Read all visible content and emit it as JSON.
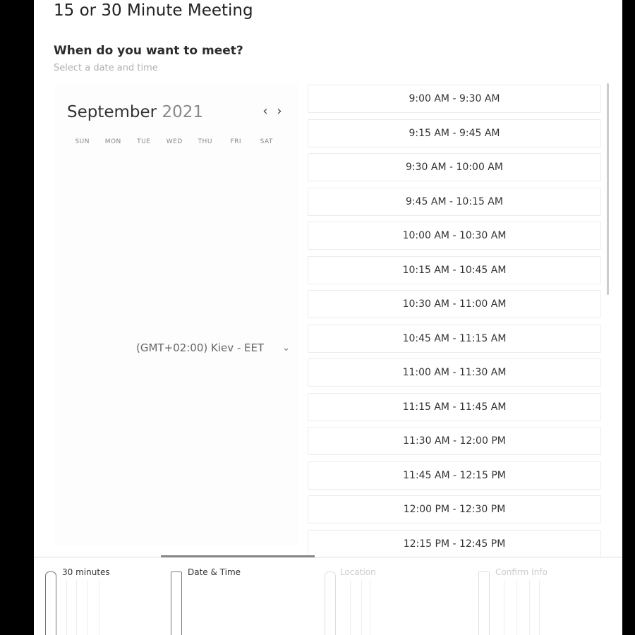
{
  "meeting": {
    "title": "15 or 30 Minute Meeting",
    "question": "When do you want to meet?",
    "hint": "Select a date and time"
  },
  "calendar": {
    "month": "September",
    "year": "2021",
    "prev_icon": "chevron-left-icon",
    "next_icon": "chevron-right-icon",
    "weekdays": [
      "SUN",
      "MON",
      "TUE",
      "WED",
      "THU",
      "FRI",
      "SAT"
    ]
  },
  "timezone": {
    "label": "(GMT+02:00) Kiev - EET",
    "icon": "chevron-down-icon"
  },
  "slots": [
    "9:00 AM - 9:30 AM",
    "9:15 AM - 9:45 AM",
    "9:30 AM - 10:00 AM",
    "9:45 AM - 10:15 AM",
    "10:00 AM - 10:30 AM",
    "10:15 AM - 10:45 AM",
    "10:30 AM - 11:00 AM",
    "10:45 AM - 11:15 AM",
    "11:00 AM - 11:30 AM",
    "11:15 AM - 11:45 AM",
    "11:30 AM - 12:00 PM",
    "11:45 AM - 12:15 PM",
    "12:00 PM - 12:30 PM",
    "12:15 PM - 12:45 PM"
  ],
  "steps": [
    {
      "label": "30 minutes",
      "icon": "clock-icon",
      "state": "active"
    },
    {
      "label": "Date & Time",
      "icon": "calendar-icon",
      "state": "active"
    },
    {
      "label": "Location",
      "icon": "location-pin-icon",
      "state": "inactive"
    },
    {
      "label": "Confirm Info",
      "icon": "checkbox-icon",
      "state": "inactive"
    }
  ],
  "colors": {
    "panel": "#ffffff",
    "backdrop": "#000000",
    "progress": "#888888"
  }
}
